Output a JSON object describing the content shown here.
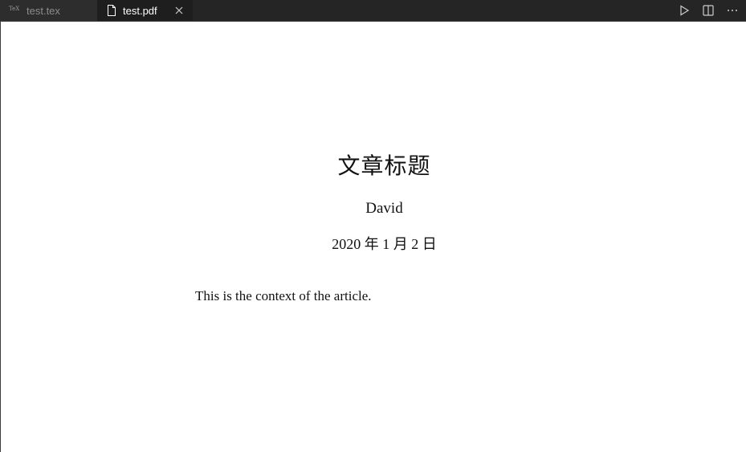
{
  "tabs": [
    {
      "logo": "TeX",
      "label": "test.tex",
      "active": false
    },
    {
      "icon": "file-icon",
      "label": "test.pdf",
      "active": true,
      "close": "×"
    }
  ],
  "toolbar": {
    "run_icon": "play-icon",
    "split_icon": "split-editor-icon",
    "more_icon": "more-icon",
    "more_label": "···"
  },
  "document": {
    "title": "文章标题",
    "author": "David",
    "date": "2020 年 1 月 2 日",
    "body": "This is the context of the article."
  },
  "colors": {
    "tabbar_bg": "#252526",
    "inactive_tab_bg": "#2d2d2d",
    "active_tab_bg": "#1e1e1e",
    "page_bg": "#ffffff"
  }
}
